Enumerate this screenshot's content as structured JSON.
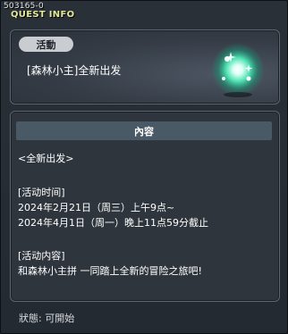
{
  "window": {
    "quest_id": "503165-0",
    "header": "QUEST INFO"
  },
  "quest": {
    "category": "活動",
    "title": "[森林小主]全新出发",
    "icon": "sparkle-orb-icon"
  },
  "content": {
    "section_title": "內容",
    "lines": [
      "<全新出发>",
      "",
      "[活动时间]",
      "2024年2月21日（周三）上午9点~",
      "2024年4月1日（周一）晚上11点59分截止",
      "",
      "[活动内容]",
      "和森林小主拼 一同踏上全新的冒险之旅吧!"
    ]
  },
  "status": {
    "label": "狀態: 可開始"
  },
  "colors": {
    "header_text": "#e4e89a",
    "accent_glow": "#7fffd4",
    "section_bar": "#4a5966"
  }
}
